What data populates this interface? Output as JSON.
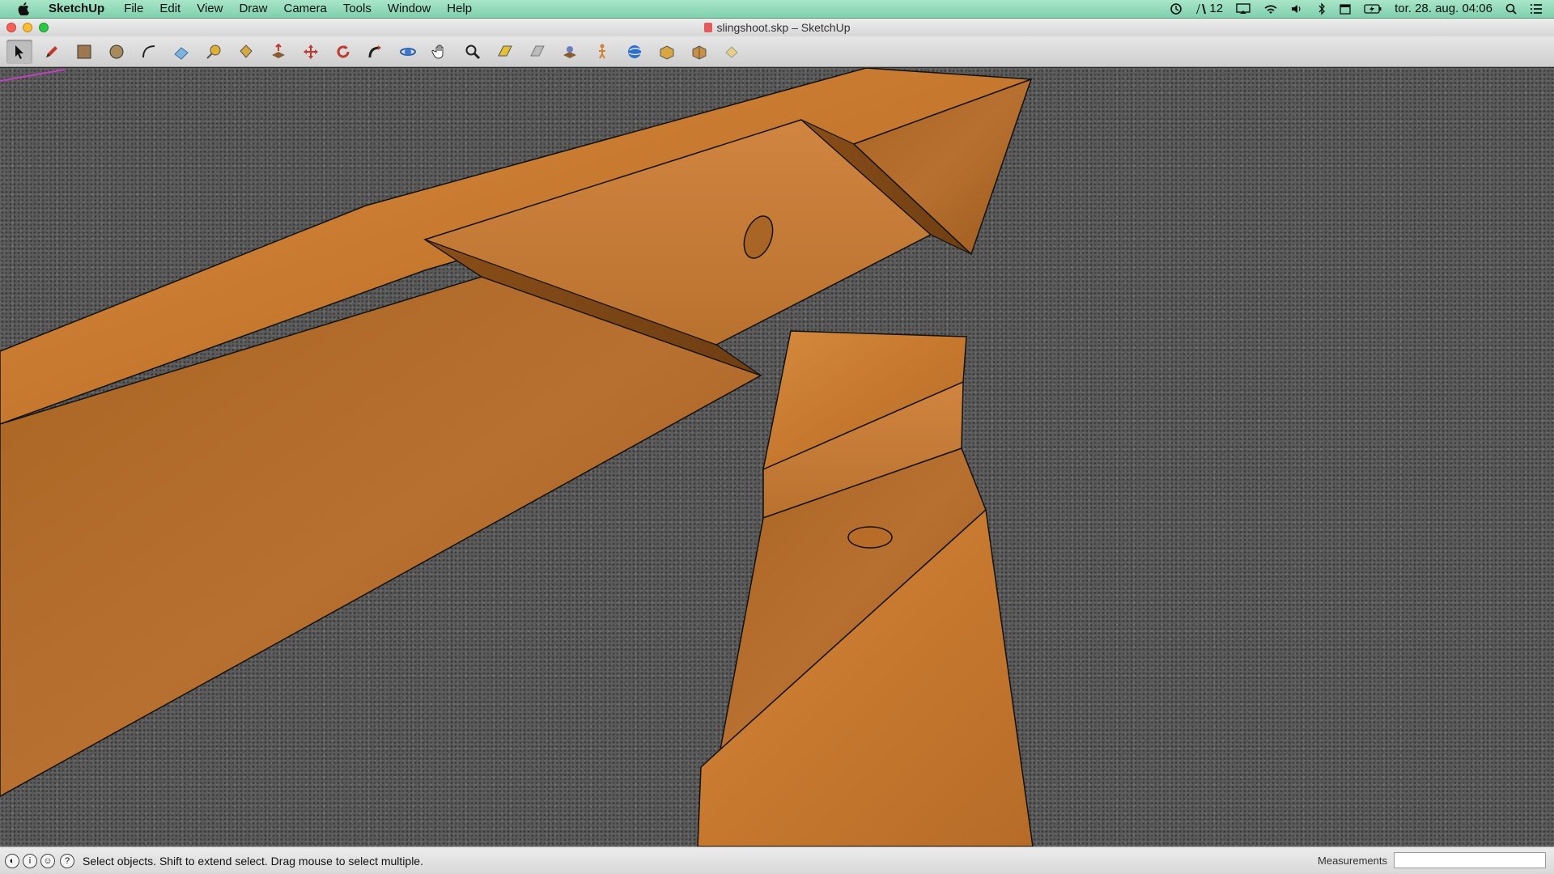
{
  "menubar": {
    "apple_icon": "apple-logo-icon",
    "app_name": "SketchUp",
    "items": [
      "File",
      "Edit",
      "View",
      "Draw",
      "Camera",
      "Tools",
      "Window",
      "Help"
    ],
    "status": {
      "adobe_count": "12",
      "datetime": "tor. 28. aug.  04:06"
    },
    "accent_color": "#8fd9b6"
  },
  "window": {
    "title": "slingshoot.skp – SketchUp"
  },
  "toolbar": {
    "tools": [
      {
        "name": "select-tool-icon",
        "active": true
      },
      {
        "name": "pencil-line-tool-icon"
      },
      {
        "name": "rectangle-tool-icon"
      },
      {
        "name": "circle-tool-icon"
      },
      {
        "name": "arc-tool-icon"
      },
      {
        "name": "eraser-tool-icon"
      },
      {
        "name": "tape-measure-tool-icon"
      },
      {
        "name": "paint-bucket-tool-icon"
      },
      {
        "name": "push-pull-tool-icon"
      },
      {
        "name": "move-tool-icon"
      },
      {
        "name": "rotate-tool-icon"
      },
      {
        "name": "follow-me-tool-icon"
      },
      {
        "name": "orbit-tool-icon"
      },
      {
        "name": "pan-tool-icon"
      },
      {
        "name": "zoom-tool-icon"
      },
      {
        "name": "zoom-extents-tool-icon"
      },
      {
        "name": "previous-view-icon"
      },
      {
        "name": "position-camera-icon"
      },
      {
        "name": "walk-tool-icon"
      },
      {
        "name": "3d-warehouse-icon"
      },
      {
        "name": "share-model-icon"
      },
      {
        "name": "get-components-icon"
      },
      {
        "name": "extension-warehouse-icon"
      }
    ]
  },
  "statusbar": {
    "message": "Select objects. Shift to extend select. Drag mouse to select multiple.",
    "measurements_label": "Measurements",
    "measurements_value": ""
  }
}
